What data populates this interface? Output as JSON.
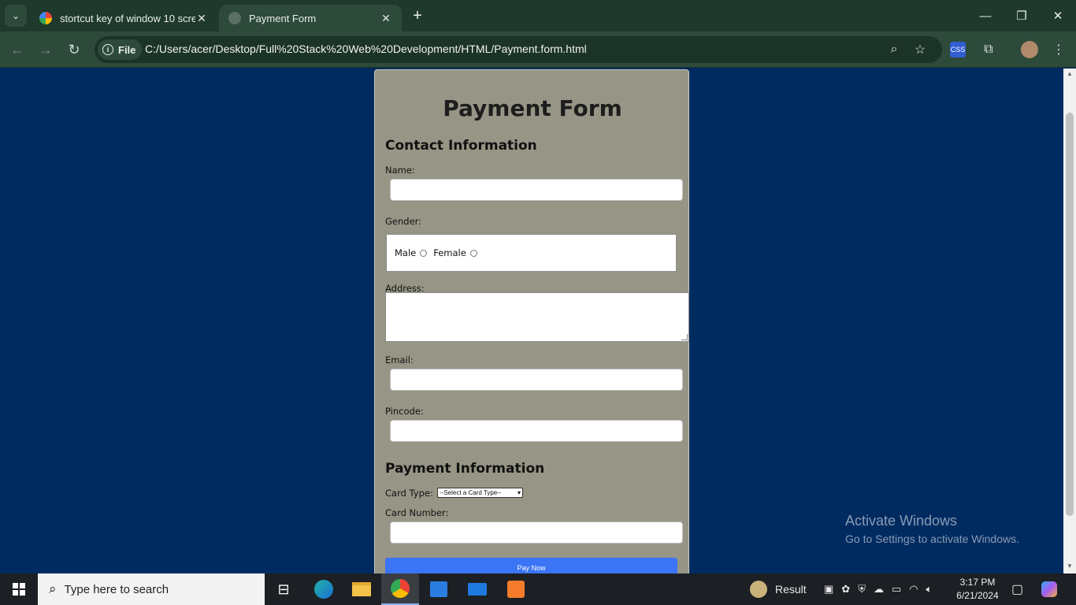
{
  "browser": {
    "tabs": [
      {
        "title": "stortcut key of window 10 scree",
        "icon": "google-icon"
      },
      {
        "title": "Payment Form",
        "icon": "page-icon"
      }
    ],
    "address": {
      "scheme_chip": "File",
      "url": "C:/Users/acer/Desktop/Full%20Stack%20Web%20Development/HTML/Payment.form.html"
    }
  },
  "form": {
    "title": "Payment Form",
    "contact_section": "Contact Information",
    "name_label": "Name:",
    "name_value": "",
    "gender_label": "Gender:",
    "gender_options": [
      "Male",
      "Female"
    ],
    "address_label": "Address:",
    "address_value": "",
    "email_label": "Email:",
    "email_value": "",
    "pincode_label": "Pincode:",
    "pincode_value": "",
    "payment_section": "Payment Information",
    "card_type_label": "Card Type:",
    "card_type_selected": "--Select a Card Type--",
    "card_number_label": "Card Number:",
    "card_number_value": "",
    "pay_button": "Pay Now"
  },
  "watermark": {
    "line1": "Activate Windows",
    "line2": "Go to Settings to activate Windows."
  },
  "taskbar": {
    "search_placeholder": "Type here to search",
    "weather_label": "Result",
    "time": "3:17 PM",
    "date": "6/21/2024"
  },
  "colors": {
    "page_background": "#002b61",
    "form_background": "#979585",
    "pay_button": "#3b74f5",
    "browser_frame": "#1f3a2c"
  }
}
